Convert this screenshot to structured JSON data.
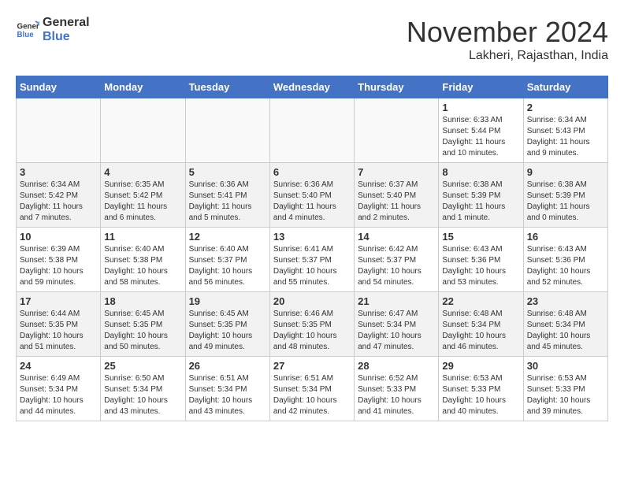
{
  "header": {
    "logo_general": "General",
    "logo_blue": "Blue",
    "month_title": "November 2024",
    "location": "Lakheri, Rajasthan, India"
  },
  "weekdays": [
    "Sunday",
    "Monday",
    "Tuesday",
    "Wednesday",
    "Thursday",
    "Friday",
    "Saturday"
  ],
  "weeks": [
    [
      {
        "day": "",
        "info": ""
      },
      {
        "day": "",
        "info": ""
      },
      {
        "day": "",
        "info": ""
      },
      {
        "day": "",
        "info": ""
      },
      {
        "day": "",
        "info": ""
      },
      {
        "day": "1",
        "info": "Sunrise: 6:33 AM\nSunset: 5:44 PM\nDaylight: 11 hours and 10 minutes."
      },
      {
        "day": "2",
        "info": "Sunrise: 6:34 AM\nSunset: 5:43 PM\nDaylight: 11 hours and 9 minutes."
      }
    ],
    [
      {
        "day": "3",
        "info": "Sunrise: 6:34 AM\nSunset: 5:42 PM\nDaylight: 11 hours and 7 minutes."
      },
      {
        "day": "4",
        "info": "Sunrise: 6:35 AM\nSunset: 5:42 PM\nDaylight: 11 hours and 6 minutes."
      },
      {
        "day": "5",
        "info": "Sunrise: 6:36 AM\nSunset: 5:41 PM\nDaylight: 11 hours and 5 minutes."
      },
      {
        "day": "6",
        "info": "Sunrise: 6:36 AM\nSunset: 5:40 PM\nDaylight: 11 hours and 4 minutes."
      },
      {
        "day": "7",
        "info": "Sunrise: 6:37 AM\nSunset: 5:40 PM\nDaylight: 11 hours and 2 minutes."
      },
      {
        "day": "8",
        "info": "Sunrise: 6:38 AM\nSunset: 5:39 PM\nDaylight: 11 hours and 1 minute."
      },
      {
        "day": "9",
        "info": "Sunrise: 6:38 AM\nSunset: 5:39 PM\nDaylight: 11 hours and 0 minutes."
      }
    ],
    [
      {
        "day": "10",
        "info": "Sunrise: 6:39 AM\nSunset: 5:38 PM\nDaylight: 10 hours and 59 minutes."
      },
      {
        "day": "11",
        "info": "Sunrise: 6:40 AM\nSunset: 5:38 PM\nDaylight: 10 hours and 58 minutes."
      },
      {
        "day": "12",
        "info": "Sunrise: 6:40 AM\nSunset: 5:37 PM\nDaylight: 10 hours and 56 minutes."
      },
      {
        "day": "13",
        "info": "Sunrise: 6:41 AM\nSunset: 5:37 PM\nDaylight: 10 hours and 55 minutes."
      },
      {
        "day": "14",
        "info": "Sunrise: 6:42 AM\nSunset: 5:37 PM\nDaylight: 10 hours and 54 minutes."
      },
      {
        "day": "15",
        "info": "Sunrise: 6:43 AM\nSunset: 5:36 PM\nDaylight: 10 hours and 53 minutes."
      },
      {
        "day": "16",
        "info": "Sunrise: 6:43 AM\nSunset: 5:36 PM\nDaylight: 10 hours and 52 minutes."
      }
    ],
    [
      {
        "day": "17",
        "info": "Sunrise: 6:44 AM\nSunset: 5:35 PM\nDaylight: 10 hours and 51 minutes."
      },
      {
        "day": "18",
        "info": "Sunrise: 6:45 AM\nSunset: 5:35 PM\nDaylight: 10 hours and 50 minutes."
      },
      {
        "day": "19",
        "info": "Sunrise: 6:45 AM\nSunset: 5:35 PM\nDaylight: 10 hours and 49 minutes."
      },
      {
        "day": "20",
        "info": "Sunrise: 6:46 AM\nSunset: 5:35 PM\nDaylight: 10 hours and 48 minutes."
      },
      {
        "day": "21",
        "info": "Sunrise: 6:47 AM\nSunset: 5:34 PM\nDaylight: 10 hours and 47 minutes."
      },
      {
        "day": "22",
        "info": "Sunrise: 6:48 AM\nSunset: 5:34 PM\nDaylight: 10 hours and 46 minutes."
      },
      {
        "day": "23",
        "info": "Sunrise: 6:48 AM\nSunset: 5:34 PM\nDaylight: 10 hours and 45 minutes."
      }
    ],
    [
      {
        "day": "24",
        "info": "Sunrise: 6:49 AM\nSunset: 5:34 PM\nDaylight: 10 hours and 44 minutes."
      },
      {
        "day": "25",
        "info": "Sunrise: 6:50 AM\nSunset: 5:34 PM\nDaylight: 10 hours and 43 minutes."
      },
      {
        "day": "26",
        "info": "Sunrise: 6:51 AM\nSunset: 5:34 PM\nDaylight: 10 hours and 43 minutes."
      },
      {
        "day": "27",
        "info": "Sunrise: 6:51 AM\nSunset: 5:34 PM\nDaylight: 10 hours and 42 minutes."
      },
      {
        "day": "28",
        "info": "Sunrise: 6:52 AM\nSunset: 5:33 PM\nDaylight: 10 hours and 41 minutes."
      },
      {
        "day": "29",
        "info": "Sunrise: 6:53 AM\nSunset: 5:33 PM\nDaylight: 10 hours and 40 minutes."
      },
      {
        "day": "30",
        "info": "Sunrise: 6:53 AM\nSunset: 5:33 PM\nDaylight: 10 hours and 39 minutes."
      }
    ]
  ]
}
